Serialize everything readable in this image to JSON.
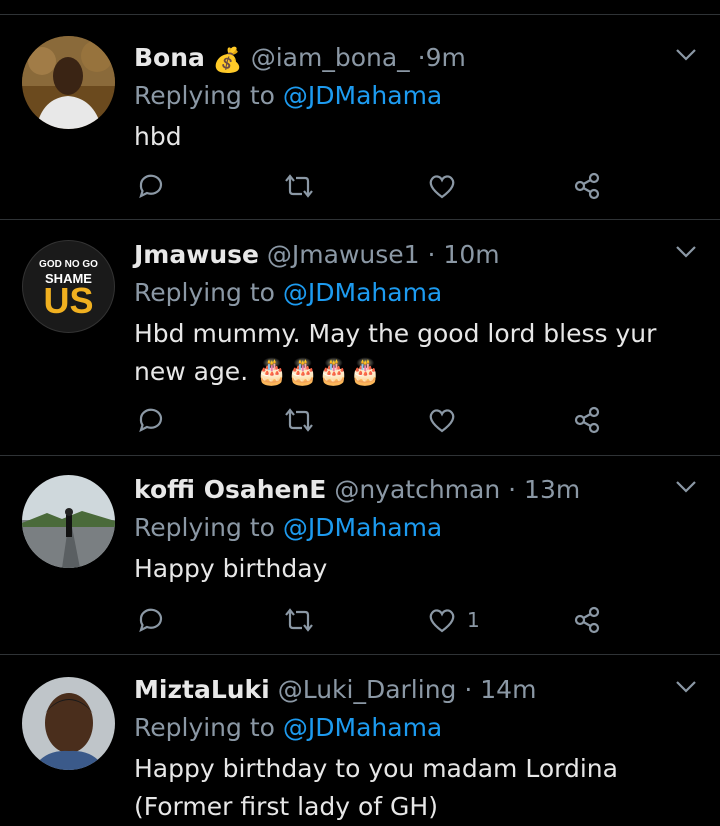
{
  "replies": [
    {
      "name": "Bona",
      "badge_emoji": "💰",
      "handle": "@iam_bona_",
      "dot": "·",
      "time": "9m",
      "replying_prefix": "Replying to",
      "replying_to": "@JDMahama",
      "text": "hbd",
      "like_count": "",
      "avatar": "person-photo"
    },
    {
      "name": "Jmawuse",
      "handle": "@Jmawuse1",
      "dot": "·",
      "time": "10m",
      "replying_prefix": "Replying to",
      "replying_to": "@JDMahama",
      "text": "Hbd mummy. May the good lord bless yur new age. 🎂🎂🎂🎂",
      "like_count": "",
      "avatar_text": {
        "line1": "GOD NO GO",
        "line2": "SHAME",
        "line3": "US"
      }
    },
    {
      "name": "koffi OsahenE",
      "handle": "@nyatchman",
      "dot": "·",
      "time": "13m",
      "replying_prefix": "Replying to",
      "replying_to": "@JDMahama",
      "text": "Happy birthday",
      "like_count": "1",
      "avatar": "landscape-photo"
    },
    {
      "name": "MiztaLuki",
      "handle": "@Luki_Darling",
      "dot": "·",
      "time": "14m",
      "replying_prefix": "Replying to",
      "replying_to": "@JDMahama",
      "text": "Happy birthday to you madam Lordina (Former first lady of GH)",
      "like_count": "",
      "avatar": "selfie-photo"
    }
  ],
  "icons": [
    "chevron-down-icon",
    "reply-icon",
    "retweet-icon",
    "like-icon",
    "share-icon"
  ],
  "colors": {
    "background": "#000000",
    "mention": "#1d9bf0",
    "secondary": "#8b98a5",
    "divider": "#2f3336"
  }
}
